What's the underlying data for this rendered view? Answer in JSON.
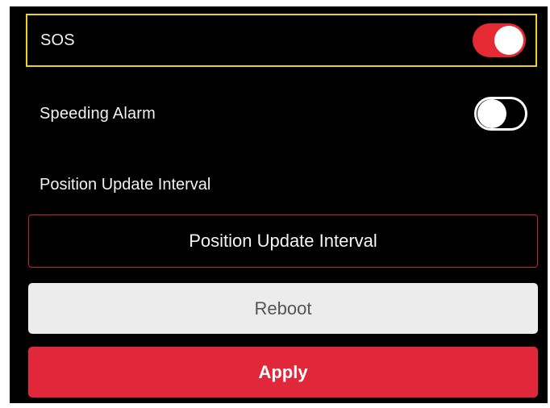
{
  "settings": {
    "sos": {
      "label": "SOS",
      "enabled": true
    },
    "speeding_alarm": {
      "label": "Speeding Alarm",
      "enabled": false
    },
    "position_update_interval": {
      "section_label": "Position Update Interval",
      "field_text": "Position Update Interval"
    }
  },
  "buttons": {
    "reboot_label": "Reboot",
    "apply_label": "Apply"
  },
  "colors": {
    "background": "#000000",
    "accent_red": "#e0283a",
    "focus_outline": "#f0d21c",
    "toggle_on": "#e52a33",
    "reboot_bg": "#ececec"
  }
}
